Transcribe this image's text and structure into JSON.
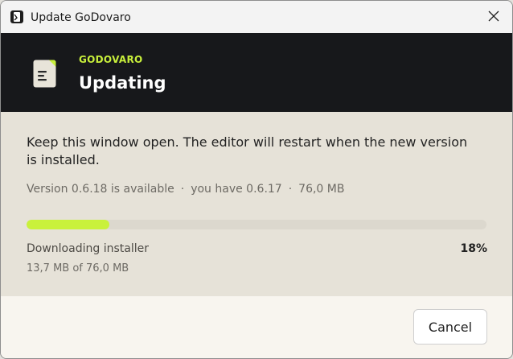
{
  "window": {
    "title": "Update GoDovaro",
    "close_icon": "close-icon",
    "app_icon": "godovaro-app-icon"
  },
  "hero": {
    "eyebrow": "GODOVARO",
    "title": "Updating",
    "icon": "document-icon",
    "background_color": "#17181b",
    "accent_color": "#c8ef3b"
  },
  "content": {
    "message": "Keep this window open. The editor will restart when the new version is installed.",
    "version_available": "Version 0.6.18 is available",
    "separator": "·",
    "version_current": "you have 0.6.17",
    "download_size": "76,0 MB"
  },
  "progress": {
    "status": "Downloading installer",
    "percent_label": "18%",
    "percent_value": 18,
    "bytes": "13,7 MB of 76,0 MB",
    "fill_color": "#c9f13b"
  },
  "footer": {
    "cancel_label": "Cancel"
  }
}
